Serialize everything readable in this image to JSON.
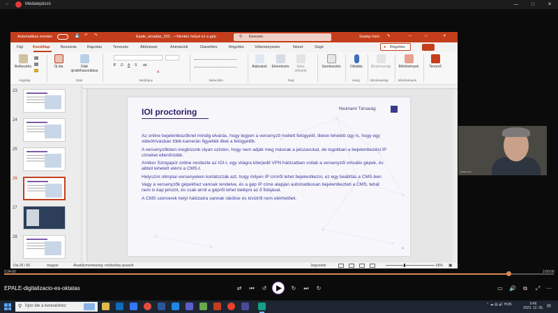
{
  "player": {
    "title": "Médialejátszó",
    "media_name": "EPALE-digitalizacio-es-oktatas",
    "time_elapsed": "0:34:00",
    "time_total": "2:00:00",
    "progress": 0.918
  },
  "ppt": {
    "autosave_label": "Automatikus mentés",
    "doc_title": "Epale_eloadas_202... • Mentés helyei ez a gép",
    "search_placeholder": "Keresés",
    "user_name": "Szalay Imre",
    "menu": [
      "Fájl",
      "Kezdőlap",
      "Beszúrás",
      "Rajzolás",
      "Tervezés",
      "Áttűnések",
      "Animációk",
      "Diavetítés",
      "Rögzítés",
      "Véleményezés",
      "Nézet",
      "Súgó"
    ],
    "active_menu": "Kezdőlap",
    "share_label": "Rögzítés",
    "ribbon": {
      "paste": "Beillesztés",
      "new_slide": "Új dia",
      "reuse_slides": "Diák újrafelhasználása",
      "shapes": "Alakzatok",
      "arrange": "Elrendezés",
      "quick_styles": "Kész stílusok",
      "editing": "Szerkesztés",
      "dictate": "Diktálás",
      "sensitivity": "Bizalmasság",
      "addins": "Bővítmények",
      "designer": "Tervező",
      "groups": [
        "Vágólap",
        "Diák",
        "Betűtípus",
        "Bekezdés",
        "Rajz",
        "Hang",
        "Bizalmasság",
        "Bővítmények"
      ]
    },
    "thumbnails": [
      {
        "num": "23",
        "selected": false,
        "dark": false
      },
      {
        "num": "24",
        "selected": false,
        "dark": false
      },
      {
        "num": "25",
        "selected": false,
        "dark": false
      },
      {
        "num": "26",
        "selected": true,
        "dark": false
      },
      {
        "num": "27",
        "selected": false,
        "dark": true
      },
      {
        "num": "28",
        "selected": false,
        "dark": false
      }
    ],
    "slide": {
      "title": "IOI proctoring",
      "author": "Neumann Társaság",
      "page": "26",
      "paragraphs": [
        "Az online bejelentkezőknél mindig elvárás, hogy legyen a versenyző mellett felügyelő, illetve lehetett úgy is, hogy egy videóhívásban több kamerán figyelték őket a felügyelők.",
        "A versenyzőkben megbízunk olyan szinten, hogy nem adják meg másnak a jelszavukat, de logokban a bejelentkezési IP címeket ellenőrizték.",
        "Amikor Szingapúr online rendezte az IOI-t, egy világra kiterjedő VPN hálózatban voltak a versenyzői virtuális gépek, és abból lehetett elérni a CMS-t.",
        "Helyszíni olimpiai versenyeken korlátozzák azt, hogy milyen IP címről lehet bejelentkezni, ez egy beállítás a CMS-ben",
        "Vagy a versenyzők gépekhez vannak rendelve, és a gép IP címe alapján automatikusan bejelentkezteti a CMS, tehát nem is kap jelszót, és csak arról a gépről lehet belépni az ő fiókjával.",
        "A CMS szerverek helyi hálózatra vannak rákötve és kívülről nem elérhetőek."
      ]
    },
    "status": {
      "slide_count": "Dia 26 / 60",
      "language": "magyar",
      "accessibility": "Akadálymentesség: módosítás javasolt",
      "notes": "Jegyzetek",
      "zoom": "66%"
    }
  },
  "webcam": {
    "name_tag": "Szalay Imre"
  },
  "taskbar": {
    "search_placeholder": "Írjon ide a kereséshez",
    "tray_lang": "HUN",
    "time": "9:46",
    "date": "2023. 12. 05."
  },
  "colors": {
    "ppt_accent": "#c43e1c",
    "slide_title": "#2e1c66",
    "slide_text": "#3a3a9a",
    "progress": "#d98a52",
    "taskbar": "#1d2530"
  }
}
